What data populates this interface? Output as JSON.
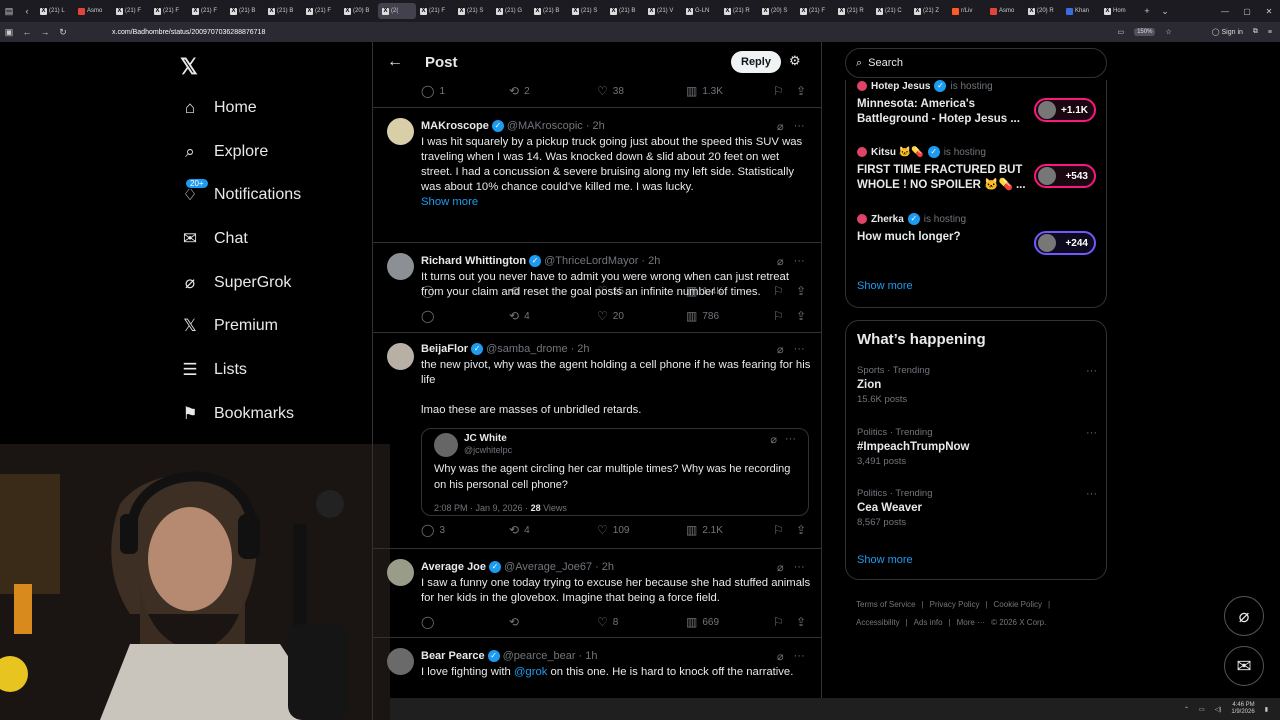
{
  "browser": {
    "tabs": [
      {
        "label": "(21) L",
        "fav": "X",
        "color": ""
      },
      {
        "label": "Asmo",
        "fav": "",
        "color": "red"
      },
      {
        "label": "(21) F",
        "fav": "X",
        "color": ""
      },
      {
        "label": "(21) F",
        "fav": "X",
        "color": ""
      },
      {
        "label": "(21) F",
        "fav": "X",
        "color": ""
      },
      {
        "label": "(21) B",
        "fav": "X",
        "color": ""
      },
      {
        "label": "(21) B",
        "fav": "X",
        "color": ""
      },
      {
        "label": "(21) F",
        "fav": "X",
        "color": ""
      },
      {
        "label": "(20) B",
        "fav": "X",
        "color": ""
      },
      {
        "label": "(2(",
        "fav": "X",
        "color": "",
        "active": true
      },
      {
        "label": "(21) F",
        "fav": "X",
        "color": ""
      },
      {
        "label": "(21) S",
        "fav": "X",
        "color": ""
      },
      {
        "label": "(21) G",
        "fav": "X",
        "color": ""
      },
      {
        "label": "(21) B",
        "fav": "X",
        "color": ""
      },
      {
        "label": "(21) S",
        "fav": "X",
        "color": ""
      },
      {
        "label": "(21) B",
        "fav": "X",
        "color": ""
      },
      {
        "label": "(21) V",
        "fav": "X",
        "color": ""
      },
      {
        "label": "G-LN",
        "fav": "X",
        "color": ""
      },
      {
        "label": "(21) R",
        "fav": "X",
        "color": ""
      },
      {
        "label": "(20) S",
        "fav": "X",
        "color": ""
      },
      {
        "label": "(21) F",
        "fav": "X",
        "color": ""
      },
      {
        "label": "(21) R",
        "fav": "X",
        "color": ""
      },
      {
        "label": "(21) C",
        "fav": "X",
        "color": ""
      },
      {
        "label": "(21) Z",
        "fav": "X",
        "color": ""
      },
      {
        "label": "r/Liv",
        "fav": "",
        "color": "orange"
      },
      {
        "label": "Asmo",
        "fav": "",
        "color": "red"
      },
      {
        "label": "(20) R",
        "fav": "X",
        "color": ""
      },
      {
        "label": "Khan",
        "fav": "",
        "color": "blue"
      },
      {
        "label": "Hom",
        "fav": "X",
        "color": ""
      }
    ],
    "url": "x.com/Badhombre/status/2009707036288876718",
    "zoom": "150%",
    "signin": "Sign in"
  },
  "nav": {
    "items": [
      {
        "label": "Home",
        "icon": "home-icon"
      },
      {
        "label": "Explore",
        "icon": "search-icon"
      },
      {
        "label": "Notifications",
        "icon": "bell-icon"
      },
      {
        "label": "Chat",
        "icon": "mail-icon"
      },
      {
        "label": "SuperGrok",
        "icon": "grok-icon"
      },
      {
        "label": "Premium",
        "icon": "x-icon"
      },
      {
        "label": "Lists",
        "icon": "list-icon"
      },
      {
        "label": "Bookmarks",
        "icon": "bookmark-icon"
      }
    ],
    "notif_badge": "20+"
  },
  "header": {
    "title": "Post",
    "reply": "Reply"
  },
  "top_actions": {
    "replies": "1",
    "reposts": "2",
    "likes": "38",
    "views": "1.3K"
  },
  "tweets": [
    {
      "name": "MAKroscope",
      "handle": "@MAKroscopic",
      "time": "2h",
      "text": "I was hit squarely by a pickup truck going just about the speed this SUV was traveling when I was 14. Was knocked down & slid about 20 feet on wet street. I had a concussion & severe bruising along my left side. Statistically was about 10% chance could've killed me. I was lucky.",
      "show_more": "Show more",
      "replies": "",
      "reposts": "",
      "likes": "15",
      "views": "1.4K"
    },
    {
      "name": "Richard Whittington",
      "handle": "@ThriceLordMayor",
      "time": "2h",
      "text": "It turns out you never have to admit you were wrong when can just retreat from your claim and reset the goal posts an infinite number of times.",
      "replies": "",
      "reposts": "4",
      "likes": "20",
      "views": "786"
    },
    {
      "name": "BeijaFlor",
      "handle": "@samba_drome",
      "time": "2h",
      "text": "the new pivot, why was the agent holding a cell phone if he was fearing for his life",
      "text2": "lmao these are masses of unbridled retards.",
      "quote": {
        "name": "JC White",
        "handle": "@jcwhitelpc",
        "text": "Why was the agent circling her car multiple times? Why was he recording on his personal cell phone?",
        "meta": "2:08 PM · Jan 9, 2026 · ",
        "views_num": "28",
        "views_label": " Views"
      },
      "replies": "3",
      "reposts": "4",
      "likes": "109",
      "views": "2.1K"
    },
    {
      "name": "Average Joe",
      "handle": "@Average_Joe67",
      "time": "2h",
      "text": "I saw a funny one today trying to excuse her because she had stuffed animals for her kids in the glovebox. Imagine that being a force field.",
      "replies": "",
      "reposts": "",
      "likes": "8",
      "views": "669"
    },
    {
      "name": "Bear Pearce",
      "handle": "@pearce_bear",
      "time": "1h",
      "text_pre": "I love fighting with ",
      "mention": "@grok",
      "text_post": " on this one. He is hard to knock off the narrative.",
      "replies": "1",
      "reposts": "",
      "likes": "",
      "views": "864"
    }
  ],
  "search": {
    "placeholder": "Search"
  },
  "live": [
    {
      "host": "Hotep Jesus",
      "status": "is hosting",
      "title": "Minnesota: America's Battleground - Hotep Jesus ...",
      "count": "+1.1K"
    },
    {
      "host": "Kitsu 🐱💊",
      "status": "is hosting",
      "title": "FIRST TIME FRACTURED BUT WHOLE ! NO SPOILER 🐱💊 ...",
      "count": "+543"
    },
    {
      "host": "Zherka",
      "status": "is hosting",
      "title": "How much longer?",
      "count": "+244"
    }
  ],
  "live_show_more": "Show more",
  "happening": {
    "title": "What’s happening",
    "trends": [
      {
        "category": "Sports · Trending",
        "topic": "Zion",
        "posts": "15.6K posts"
      },
      {
        "category": "Politics · Trending",
        "topic": "#ImpeachTrumpNow",
        "posts": "3,491 posts"
      },
      {
        "category": "Politics · Trending",
        "topic": "Cea Weaver",
        "posts": "8,567 posts"
      }
    ],
    "show_more": "Show more"
  },
  "footer": {
    "links": [
      "Terms of Service",
      "|",
      "Privacy Policy",
      "|",
      "Cookie Policy",
      "|"
    ],
    "links2": [
      "Accessibility",
      "|",
      "Ads info",
      "|",
      "More ···",
      "© 2026 X Corp."
    ]
  },
  "taskbar": {
    "time": "4:46 PM",
    "date": "1/9/2026"
  },
  "colors": {
    "accent": "#1d9bf0",
    "background": "#000000",
    "border": "#2f3336",
    "muted": "#71767b",
    "live_pill": "#f91880"
  }
}
